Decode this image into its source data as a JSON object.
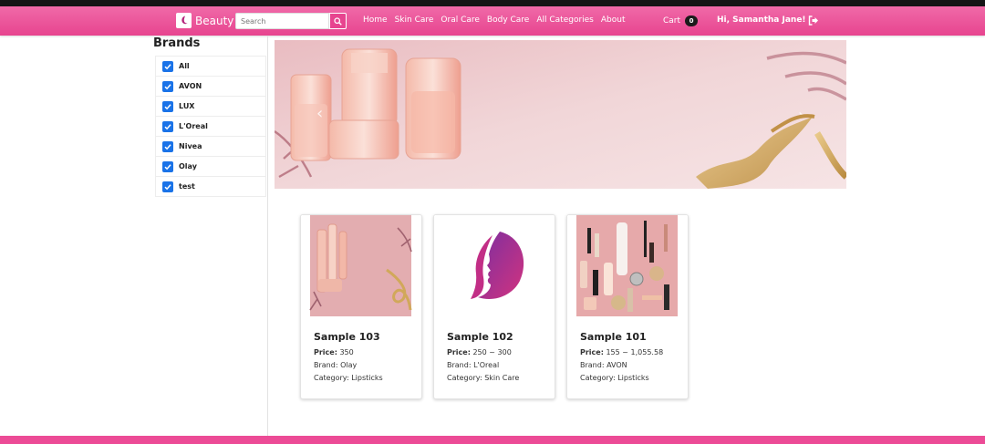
{
  "header": {
    "brand": "Beauty",
    "search_placeholder": "Search",
    "nav": [
      "Home",
      "Skin Care",
      "Oral Care",
      "Body Care",
      "All Categories",
      "About"
    ],
    "cart_label": "Cart",
    "cart_count": "0",
    "greeting": "Hi, Samantha Jane!"
  },
  "sidebar": {
    "title": "Brands",
    "brands": [
      {
        "label": "All",
        "checked": true
      },
      {
        "label": "AVON",
        "checked": true
      },
      {
        "label": "LUX",
        "checked": true
      },
      {
        "label": "L'Oreal",
        "checked": true
      },
      {
        "label": "Nivea",
        "checked": true
      },
      {
        "label": "Olay",
        "checked": true
      },
      {
        "label": "test",
        "checked": true
      }
    ]
  },
  "products": [
    {
      "name": "Sample 103",
      "price_label": "Price:",
      "price": "350",
      "brand_label": "Brand:",
      "brand": "Olay",
      "category_label": "Category:",
      "category": "Lipsticks",
      "image": "pink-serum-bottles"
    },
    {
      "name": "Sample 102",
      "price_label": "Price:",
      "price": "250 ~ 300",
      "brand_label": "Brand:",
      "brand": "L'Oreal",
      "category_label": "Category:",
      "category": "Skin Care",
      "image": "woman-face-logo"
    },
    {
      "name": "Sample 101",
      "price_label": "Price:",
      "price": "155 ~ 1,055.58",
      "brand_label": "Brand:",
      "brand": "AVON",
      "category_label": "Category:",
      "category": "Lipsticks",
      "image": "makeup-flatlay"
    }
  ],
  "colors": {
    "nav_pink": "#e7448f",
    "nav_pink_light": "#f06aa8",
    "checkbox_blue": "#1a73e8",
    "footer_pink": "#ec4b96"
  }
}
